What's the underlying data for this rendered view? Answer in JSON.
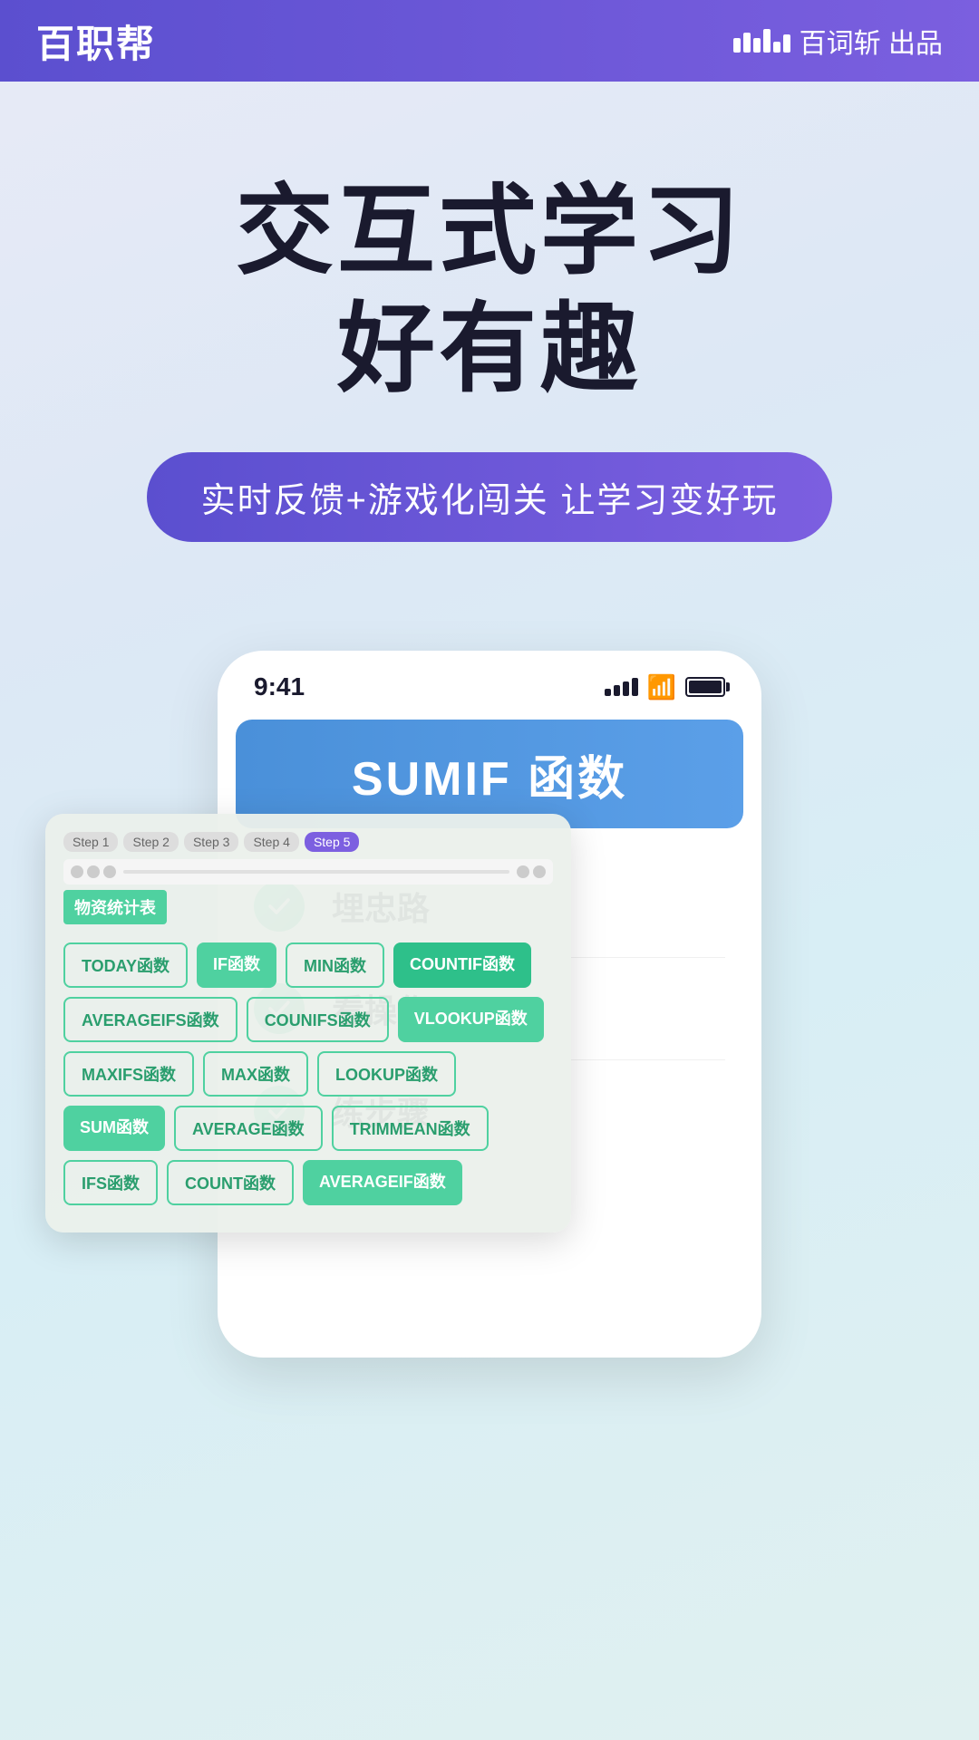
{
  "header": {
    "logo": "百职帮",
    "brand_icon_label": "百词斩 出品"
  },
  "hero": {
    "title_line1": "交互式学习",
    "title_line2": "好有趣",
    "subtitle_pill": "实时反馈+游戏化闯关  让学习变好玩"
  },
  "phone": {
    "time": "9:41",
    "sumif_label": "SUMIF 函数"
  },
  "steps": [
    {
      "id": "Step 1",
      "active": false
    },
    {
      "id": "Step 2",
      "active": false
    },
    {
      "id": "Step 3",
      "active": false
    },
    {
      "id": "Step 4",
      "active": false
    },
    {
      "id": "Step 5",
      "active": true
    }
  ],
  "spreadsheet_title": "物资统计表",
  "function_tags": [
    {
      "label": "TODAY函数",
      "style": "green-outline"
    },
    {
      "label": "IF函数",
      "style": "green-solid"
    },
    {
      "label": "MIN函数",
      "style": "green-outline"
    },
    {
      "label": "COUNTIF函数",
      "style": "green-dark"
    },
    {
      "label": "AVERAGEIFS函数",
      "style": "green-outline"
    },
    {
      "label": "COUNIFS函数",
      "style": "green-outline"
    },
    {
      "label": "VLOOKUP函数",
      "style": "green-solid"
    },
    {
      "label": "MAXIFS函数",
      "style": "green-outline"
    },
    {
      "label": "MAX函数",
      "style": "green-outline"
    },
    {
      "label": "LOOKUP函数",
      "style": "green-outline"
    },
    {
      "label": "SUM函数",
      "style": "green-solid"
    },
    {
      "label": "AVERAGE函数",
      "style": "green-outline"
    },
    {
      "label": "TRIMMEAN函数",
      "style": "green-outline"
    },
    {
      "label": "IFS函数",
      "style": "green-outline"
    },
    {
      "label": "COUNT函数",
      "style": "green-outline"
    },
    {
      "label": "AVERAGEIF函数",
      "style": "green-solid"
    }
  ],
  "checklist": [
    {
      "label": "埋忠路"
    },
    {
      "label": "看操作"
    },
    {
      "label": "练步骤"
    }
  ]
}
